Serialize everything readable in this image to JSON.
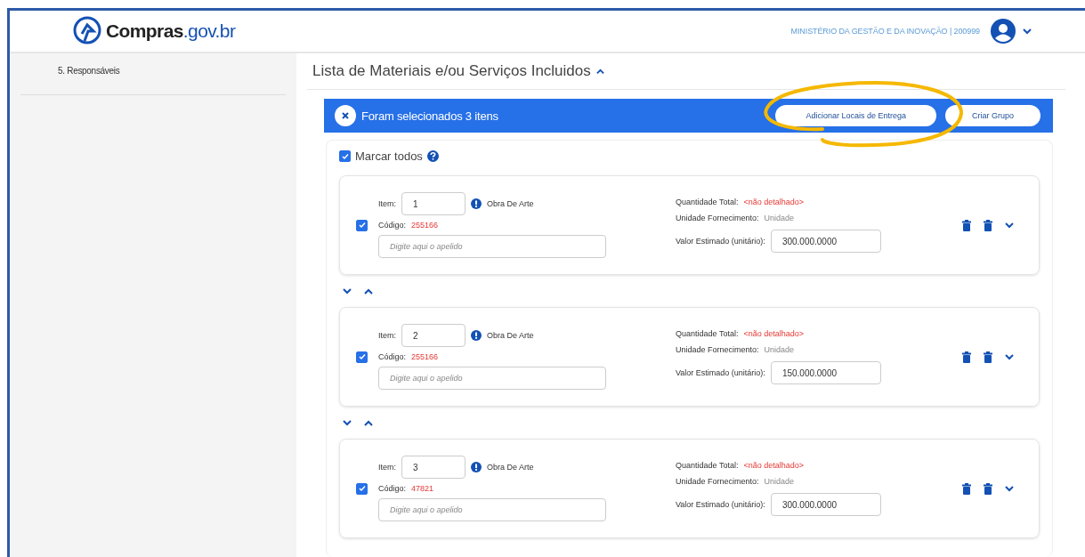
{
  "header": {
    "logo": {
      "name": "Compras",
      "domain": ".gov.br"
    },
    "organization": "MINISTÉRIO DA GESTÃO E DA INOVAÇÃO | 200999"
  },
  "sidebar": {
    "items": [
      {
        "label": "5. Responsáveis"
      }
    ]
  },
  "section": {
    "title": "Lista de Materiais e/ou Serviços Incluidos",
    "expanded": true
  },
  "selection_bar": {
    "message": "Foram selecionados 3 itens",
    "buttons": [
      "Adicionar Locais de Entrega",
      "Criar Grupo"
    ]
  },
  "select_all": {
    "label": "Marcar todos",
    "checked": true
  },
  "items": [
    {
      "checked": true,
      "item_label": "Item:",
      "item_number": "1",
      "description": "Obra De Arte",
      "code_label": "Código:",
      "code": "255166",
      "nickname_placeholder": "Digite aqui o apelido",
      "quantity_label": "Quantidade Total:",
      "quantity": "<não detalhado>",
      "unit_label": "Unidade Fornecimento:",
      "unit": "Unidade",
      "value_label": "Valor Estimado (unitário):",
      "value": "300.000.0000"
    },
    {
      "checked": true,
      "item_label": "Item:",
      "item_number": "2",
      "description": "Obra De Arte",
      "code_label": "Código:",
      "code": "255166",
      "nickname_placeholder": "Digite aqui o apelido",
      "quantity_label": "Quantidade Total:",
      "quantity": "<não detalhado>",
      "unit_label": "Unidade Fornecimento:",
      "unit": "Unidade",
      "value_label": "Valor Estimado (unitário):",
      "value": "150.000.0000"
    },
    {
      "checked": true,
      "item_label": "Item:",
      "item_number": "3",
      "description": "Obra De Arte",
      "code_label": "Código:",
      "code": "47821",
      "nickname_placeholder": "Digite aqui o apelido",
      "quantity_label": "Quantidade Total:",
      "quantity": "<não detalhado>",
      "unit_label": "Unidade Fornecimento:",
      "unit": "Unidade",
      "value_label": "Valor Estimado (unitário):",
      "value": "300.000.0000"
    }
  ]
}
